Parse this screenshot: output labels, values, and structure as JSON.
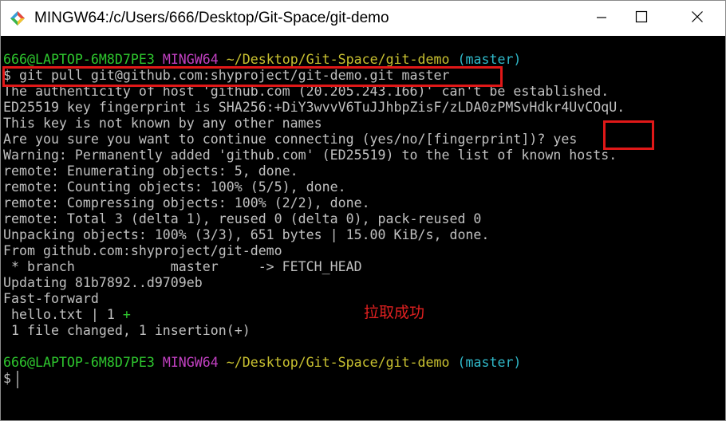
{
  "window": {
    "title": "MINGW64:/c/Users/666/Desktop/Git-Space/git-demo",
    "icons": {
      "app": "mingw-diamond-icon",
      "minimize": "minimize-icon",
      "maximize": "maximize-icon",
      "close": "close-icon"
    }
  },
  "colors": {
    "background": "#000000",
    "text": "#c0c0c0",
    "prompt_user": "#2ec72e",
    "prompt_env": "#c040c0",
    "prompt_path": "#c8c030",
    "prompt_branch": "#30b8c8",
    "highlight": "#e01818"
  },
  "terminal": {
    "prompt1": {
      "user": "666@LAPTOP-6M8D7PE3",
      "env": "MINGW64",
      "path": "~/Desktop/Git-Space/git-demo",
      "branch": "(master)"
    },
    "command": "$ git pull git@github.com:shyproject/git-demo.git master",
    "output": [
      "The authenticity of host 'github.com (20.205.243.166)' can't be established.",
      "ED25519 key fingerprint is SHA256:+DiY3wvvV6TuJJhbpZisF/zLDA0zPMSvHdkr4UvCOqU.",
      "This key is not known by any other names"
    ],
    "confirm_question": "Are you sure you want to continue connecting (yes/no/[fingerprint])?",
    "confirm_answer": "yes",
    "output2": [
      "Warning: Permanently added 'github.com' (ED25519) to the list of known hosts.",
      "remote: Enumerating objects: 5, done.",
      "remote: Counting objects: 100% (5/5), done.",
      "remote: Compressing objects: 100% (2/2), done.",
      "remote: Total 3 (delta 1), reused 0 (delta 0), pack-reused 0",
      "Unpacking objects: 100% (3/3), 651 bytes | 15.00 KiB/s, done.",
      "From github.com:shyproject/git-demo",
      " * branch            master     -> FETCH_HEAD",
      "Updating 81b7892..d9709eb",
      "Fast-forward"
    ],
    "diffstat_file": " hello.txt | 1 ",
    "diffstat_plus": "+",
    "summary": " 1 file changed, 1 insertion(+)",
    "prompt2": {
      "user": "666@LAPTOP-6M8D7PE3",
      "env": "MINGW64",
      "path": "~/Desktop/Git-Space/git-demo",
      "branch": "(master)"
    },
    "final_prompt": "$"
  },
  "annotation": {
    "text": "拉取成功"
  }
}
